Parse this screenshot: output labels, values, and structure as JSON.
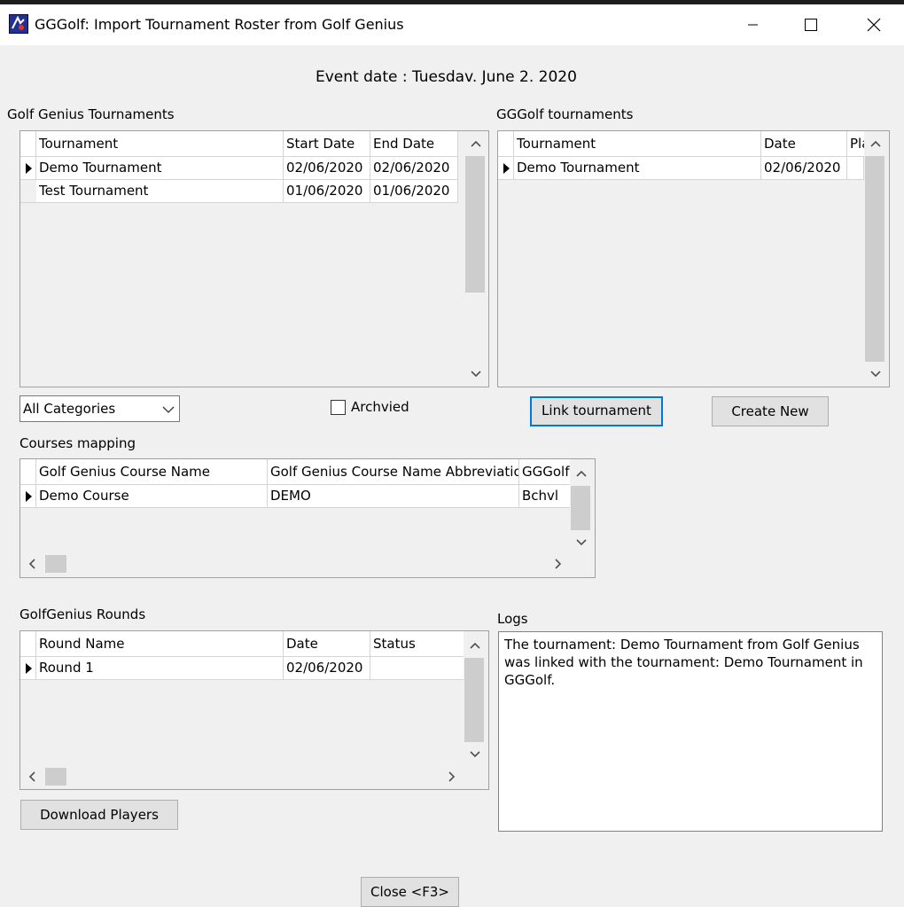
{
  "window": {
    "title": "GGGolf: Import Tournament Roster from Golf Genius",
    "icon": "app-golf-icon"
  },
  "event_date": "Event date : Tuesdav. June 2. 2020",
  "gg_tournaments": {
    "label": "Golf Genius Tournaments",
    "columns": [
      "Tournament",
      "Start Date",
      "End Date"
    ],
    "rows": [
      {
        "name": "Demo Tournament",
        "start": "02/06/2020",
        "end": "02/06/2020",
        "current": true
      },
      {
        "name": "Test Tournament",
        "start": "01/06/2020",
        "end": "01/06/2020",
        "current": false
      }
    ]
  },
  "gggolf_tournaments": {
    "label": "GGGolf tournaments",
    "columns": [
      "Tournament",
      "Date",
      "Pla"
    ],
    "rows": [
      {
        "name": "Demo Tournament",
        "date": "02/06/2020",
        "place": "",
        "current": true
      }
    ]
  },
  "category_select": {
    "value": "All Categories"
  },
  "archived_checkbox": {
    "label": "Archvied",
    "checked": false
  },
  "buttons": {
    "link": "Link tournament",
    "create": "Create New",
    "download": "Download Players",
    "close": "Close <F3>"
  },
  "courses": {
    "label": "Courses mapping",
    "columns": [
      "Golf Genius Course Name",
      "Golf Genius Course Name Abbreviation",
      "GGGolf"
    ],
    "rows": [
      {
        "name": "Demo Course",
        "abbr": "DEMO",
        "gggolf": "Bchvl",
        "current": true
      }
    ]
  },
  "rounds": {
    "label": "GolfGenius Rounds",
    "columns": [
      "Round Name",
      "Date",
      "Status"
    ],
    "rows": [
      {
        "name": "Round 1",
        "date": "02/06/2020",
        "status": "",
        "current": true
      }
    ]
  },
  "logs": {
    "label": "Logs",
    "text": "The tournament: Demo Tournament from Golf Genius was linked with the tournament: Demo Tournament in GGGolf."
  }
}
